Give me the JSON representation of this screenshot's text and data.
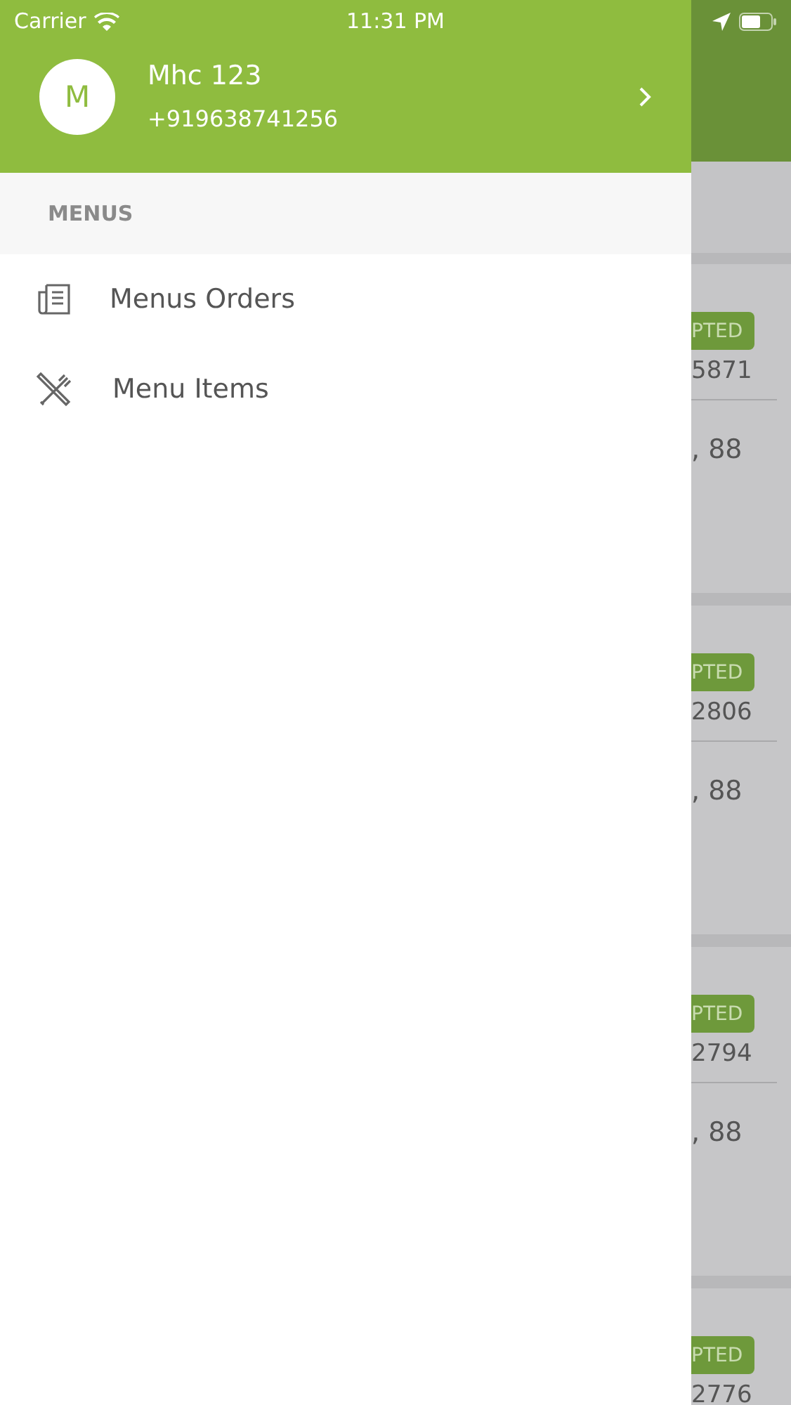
{
  "status_bar": {
    "carrier": "Carrier",
    "time": "11:31 PM"
  },
  "profile": {
    "initial": "M",
    "name": "Mhc 123",
    "phone": "+919638741256"
  },
  "section": {
    "title": "MENUS"
  },
  "menu_items": [
    {
      "kind": "orders",
      "label": "Menus Orders"
    },
    {
      "kind": "items",
      "label": "Menu Items"
    }
  ],
  "background_cards": [
    {
      "badge": "PTED",
      "number": "5871",
      "detail": ", 88"
    },
    {
      "badge": "PTED",
      "number": "2806",
      "detail": ", 88"
    },
    {
      "badge": "PTED",
      "number": "2794",
      "detail": ", 88"
    },
    {
      "badge": "PTED",
      "number": "2776"
    }
  ]
}
